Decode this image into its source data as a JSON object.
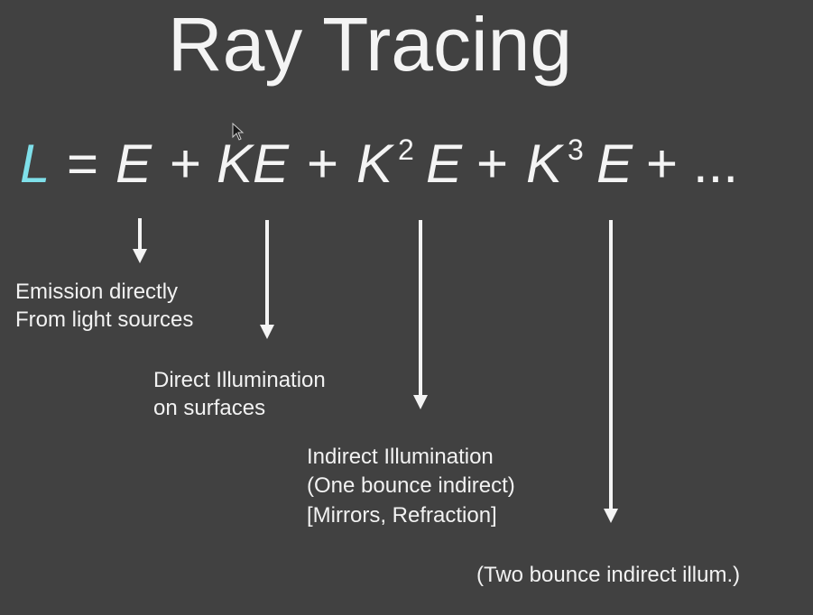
{
  "slide": {
    "title": "Ray Tracing",
    "equation": {
      "L": "L",
      "eq": "=",
      "E1": "E",
      "plus1": "+",
      "KE": "KE",
      "plus2": "+",
      "K2": "K",
      "exp2": "2",
      "E2": "E",
      "plus3": "+",
      "K3": "K",
      "exp3": "3",
      "E3": "E",
      "plus4": "+",
      "ellipsis": "..."
    },
    "labels": {
      "emission_1": "Emission directly",
      "emission_2": "From light sources",
      "direct_1": "Direct Illumination",
      "direct_2": "on surfaces",
      "indirect_1": "Indirect Illumination",
      "indirect_2": "(One bounce indirect)",
      "indirect_3": "[Mirrors, Refraction]",
      "two_bounce": "(Two bounce indirect illum.)"
    },
    "colors": {
      "background": "#414141",
      "text": "#f2f2f2",
      "accent_L": "#7fe0ea"
    }
  }
}
